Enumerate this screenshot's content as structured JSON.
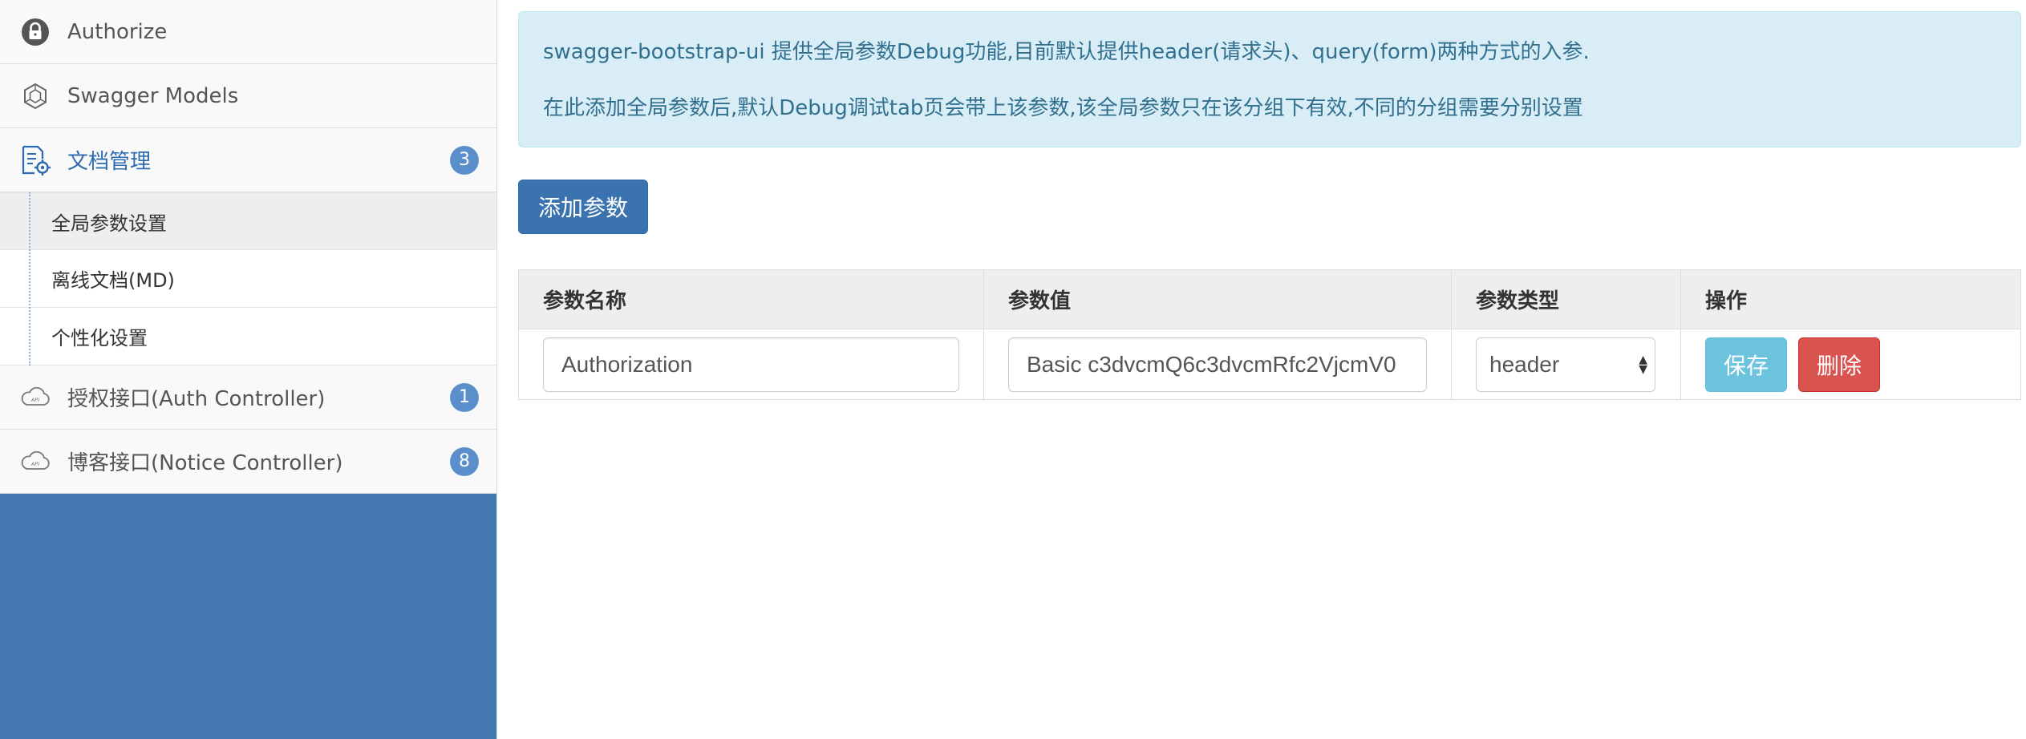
{
  "sidebar": {
    "items": [
      {
        "label": "Authorize",
        "icon": "lock-icon"
      },
      {
        "label": "Swagger Models",
        "icon": "models-icon"
      },
      {
        "label": "文档管理",
        "icon": "document-settings-icon",
        "badge": "3",
        "active": true
      },
      {
        "label": "授权接口(Auth Controller)",
        "icon": "api-cloud-icon",
        "badge": "1"
      },
      {
        "label": "博客接口(Notice Controller)",
        "icon": "api-cloud-icon",
        "badge": "8"
      }
    ],
    "submenu": [
      {
        "label": "全局参数设置",
        "selected": true
      },
      {
        "label": "离线文档(MD)"
      },
      {
        "label": "个性化设置"
      }
    ]
  },
  "main": {
    "alert": {
      "line1": "swagger-bootstrap-ui 提供全局参数Debug功能,目前默认提供header(请求头)、query(form)两种方式的入参.",
      "line2": "在此添加全局参数后,默认Debug调试tab页会带上该参数,该全局参数只在该分组下有效,不同的分组需要分别设置"
    },
    "add_button": "添加参数",
    "table": {
      "headers": [
        "参数名称",
        "参数值",
        "参数类型",
        "操作"
      ],
      "rows": [
        {
          "name": "Authorization",
          "value": "Basic c3dvcmQ6c3dvcmRfc2VjcmV0",
          "type": "header",
          "save_label": "保存",
          "delete_label": "删除"
        }
      ]
    }
  },
  "colors": {
    "sidebar_bg": "#4378b3",
    "badge": "#5a8fcb",
    "alert_bg": "#d9edf7",
    "alert_text": "#31708f",
    "primary": "#3a73b0",
    "info": "#6cc3dd",
    "danger": "#d9534f"
  }
}
